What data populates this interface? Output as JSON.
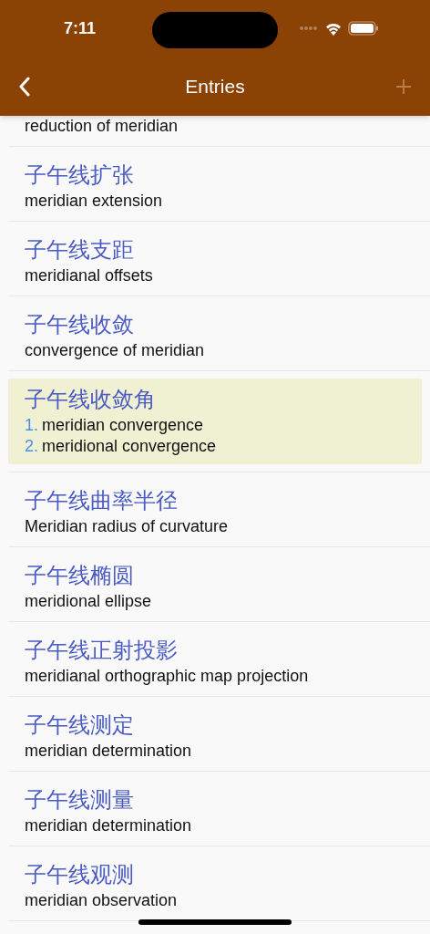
{
  "status_bar": {
    "time": "7:11"
  },
  "nav_bar": {
    "title": "Entries",
    "add_enabled": false
  },
  "entries": [
    {
      "meanings": [
        {
          "text": "reduction of meridian"
        }
      ],
      "selected": false
    },
    {
      "term": "子午线扩张",
      "meanings": [
        {
          "text": "meridian extension"
        }
      ],
      "selected": false
    },
    {
      "term": "子午线支距",
      "meanings": [
        {
          "text": "meridianal offsets"
        }
      ],
      "selected": false
    },
    {
      "term": "子午线收敛",
      "meanings": [
        {
          "text": "convergence of meridian"
        }
      ],
      "selected": false
    },
    {
      "term": "子午线收敛角",
      "meanings": [
        {
          "number": "1.",
          "text": "meridian convergence"
        },
        {
          "number": "2.",
          "text": "meridional convergence"
        }
      ],
      "selected": true
    },
    {
      "term": "子午线曲率半径",
      "meanings": [
        {
          "text": "Meridian radius of curvature"
        }
      ],
      "selected": false
    },
    {
      "term": "子午线椭圆",
      "meanings": [
        {
          "text": "meridional ellipse"
        }
      ],
      "selected": false
    },
    {
      "term": "子午线正射投影",
      "meanings": [
        {
          "text": "meridianal orthographic map projection"
        }
      ],
      "selected": false
    },
    {
      "term": "子午线测定",
      "meanings": [
        {
          "text": "meridian determination"
        }
      ],
      "selected": false
    },
    {
      "term": "子午线测量",
      "meanings": [
        {
          "text": "meridian determination"
        }
      ],
      "selected": false
    },
    {
      "term": "子午线观测",
      "meanings": [
        {
          "text": "meridian observation"
        }
      ],
      "selected": false
    }
  ]
}
